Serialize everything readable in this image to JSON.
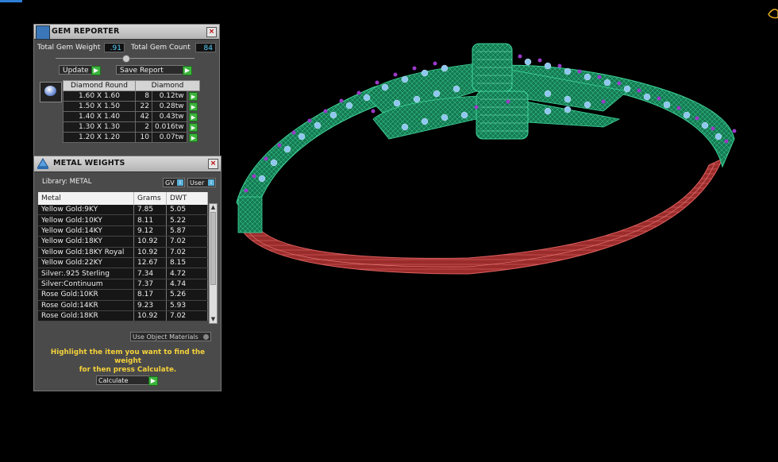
{
  "gem_reporter": {
    "title": "GEM REPORTER",
    "total_weight_label": "Total Gem Weight",
    "total_weight_value": ".91",
    "total_count_label": "Total Gem Count",
    "total_count_value": "84",
    "update_label": "Update",
    "save_report_label": "Save Report",
    "table_headers": [
      "Diamond Round",
      "Diamond"
    ],
    "rows": [
      {
        "size": "1.60 X 1.60",
        "count": "8",
        "weight": "0.12tw"
      },
      {
        "size": "1.50 X 1.50",
        "count": "22",
        "weight": "0.28tw"
      },
      {
        "size": "1.40 X 1.40",
        "count": "42",
        "weight": "0.43tw"
      },
      {
        "size": "1.30 X 1.30",
        "count": "2",
        "weight": "0.016tw"
      },
      {
        "size": "1.20 X 1.20",
        "count": "10",
        "weight": "0.07tw"
      }
    ]
  },
  "metal_weights": {
    "title": "METAL WEIGHTS",
    "library_label": "Library: METAL",
    "gv_label": "GV",
    "user_label": "User",
    "headers": [
      "Metal",
      "Grams",
      "DWT"
    ],
    "rows": [
      {
        "metal": "Yellow Gold:9KY",
        "grams": "7.85",
        "dwt": "5.05"
      },
      {
        "metal": "Yellow Gold:10KY",
        "grams": "8.11",
        "dwt": "5.22"
      },
      {
        "metal": "Yellow Gold:14KY",
        "grams": "9.12",
        "dwt": "5.87"
      },
      {
        "metal": "Yellow Gold:18KY",
        "grams": "10.92",
        "dwt": "7.02"
      },
      {
        "metal": "Yellow Gold:18KY Royal",
        "grams": "10.92",
        "dwt": "7.02"
      },
      {
        "metal": "Yellow Gold:22KY",
        "grams": "12.67",
        "dwt": "8.15"
      },
      {
        "metal": "Silver:.925 Sterling",
        "grams": "7.34",
        "dwt": "4.72"
      },
      {
        "metal": "Silver:Continuum",
        "grams": "7.37",
        "dwt": "4.74"
      },
      {
        "metal": "Rose Gold:10KR",
        "grams": "8.17",
        "dwt": "5.26"
      },
      {
        "metal": "Rose Gold:14KR",
        "grams": "9.23",
        "dwt": "5.93"
      },
      {
        "metal": "Rose Gold:18KR",
        "grams": "10.92",
        "dwt": "7.02"
      }
    ],
    "use_object_materials_label": "Use Object Materials",
    "hint_line1": "Highlight the item you want to find the weight",
    "hint_line2": "for then press Calculate.",
    "calculate_label": "Calculate"
  },
  "colors": {
    "setting_green": "#1e9a68",
    "shank_red": "#c23a3a",
    "stone_blue": "#8ec7ef",
    "prong_purple": "#9a3ac8",
    "action_green": "#3cb43c",
    "hint_yellow": "#f6d23a"
  }
}
